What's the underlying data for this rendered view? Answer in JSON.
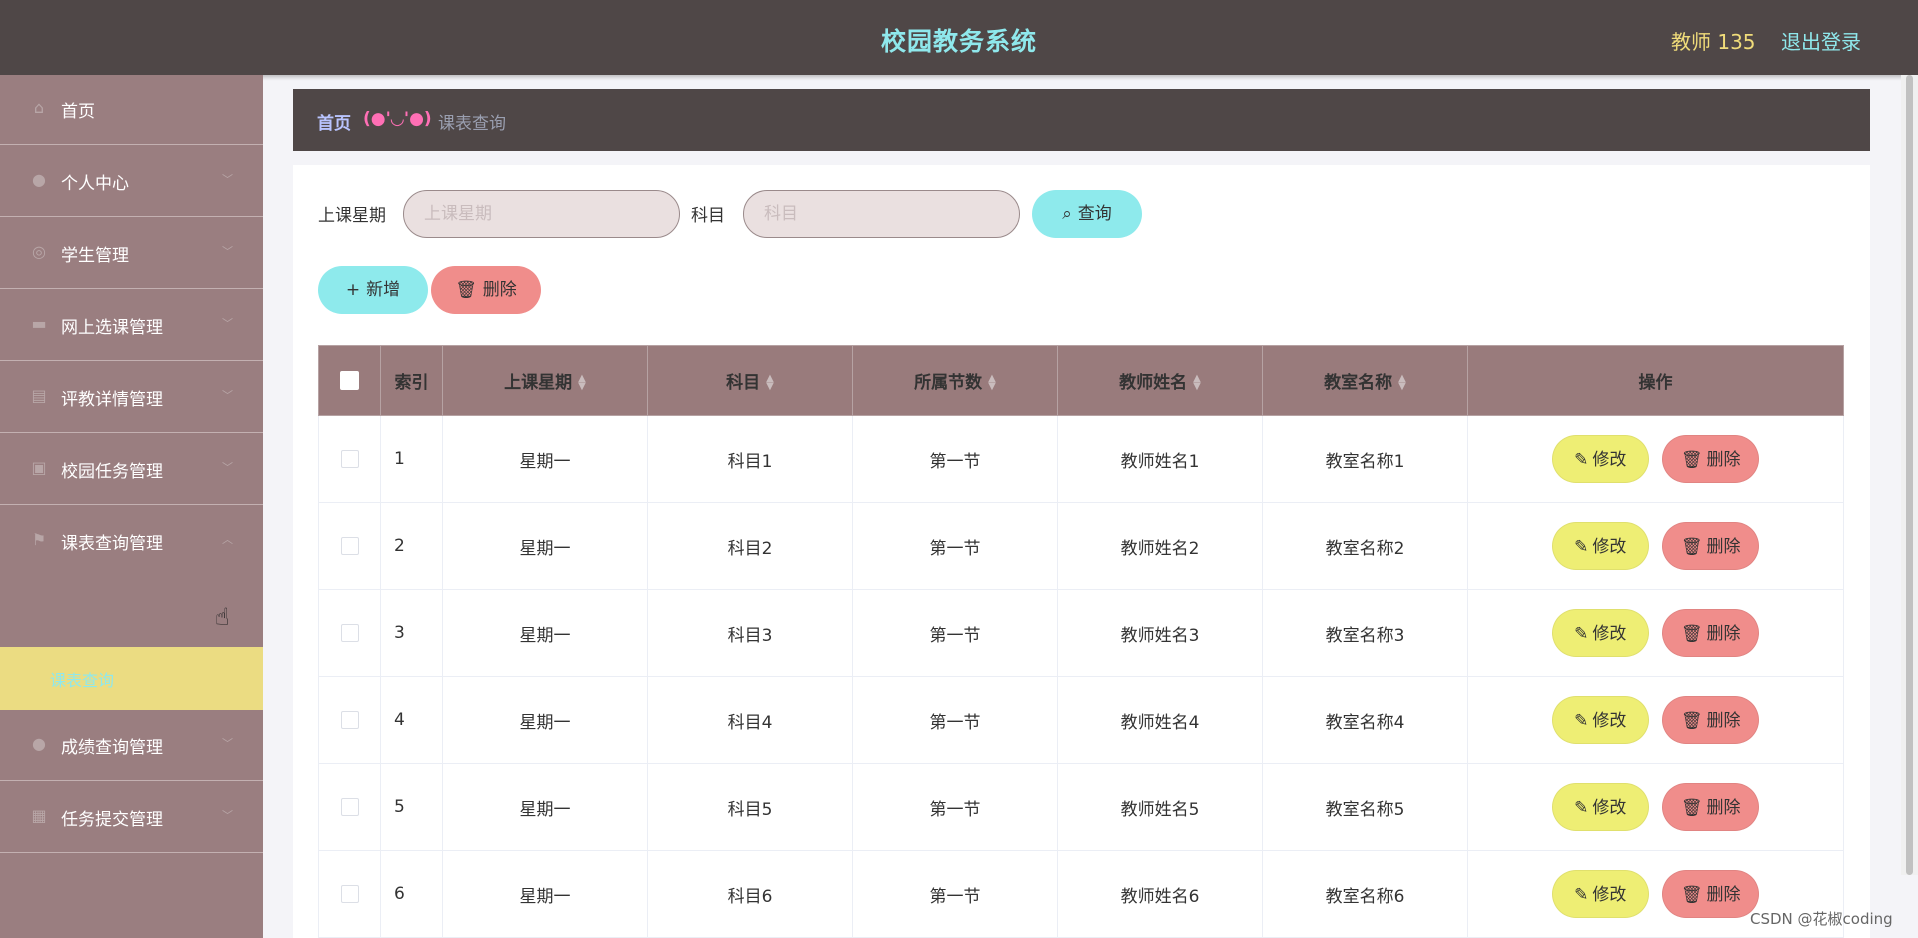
{
  "header": {
    "title": "校园教务系统",
    "user": "教师 135",
    "logout": "退出登录"
  },
  "sidebar": {
    "items": [
      {
        "label": "首页",
        "icon": "home-icon",
        "glyph": "⌂",
        "chevron": ""
      },
      {
        "label": "个人中心",
        "icon": "user-icon",
        "glyph": "●",
        "chevron": "﹀"
      },
      {
        "label": "学生管理",
        "icon": "compass-icon",
        "glyph": "◎",
        "chevron": "﹀"
      },
      {
        "label": "网上选课管理",
        "icon": "monitor-icon",
        "glyph": "▬",
        "chevron": "﹀"
      },
      {
        "label": "评教详情管理",
        "icon": "clipboard-icon",
        "glyph": "▤",
        "chevron": "﹀"
      },
      {
        "label": "校园任务管理",
        "icon": "wallet-icon",
        "glyph": "▣",
        "chevron": "﹀"
      },
      {
        "label": "课表查询管理",
        "icon": "flag-icon",
        "glyph": "⚑",
        "chevron": "︿"
      },
      {
        "label": "成绩查询管理",
        "icon": "person-icon",
        "glyph": "●",
        "chevron": "﹀"
      },
      {
        "label": "任务提交管理",
        "icon": "grid-icon",
        "glyph": "▦",
        "chevron": "﹀"
      }
    ],
    "active_sub": "课表查询"
  },
  "breadcrumb": {
    "home": "首页",
    "emoticon": "(●'◡'●)",
    "current": "课表查询"
  },
  "search": {
    "weekday_label": "上课星期",
    "weekday_placeholder": "上课星期",
    "subject_label": "科目",
    "subject_placeholder": "科目",
    "query_button": "查询"
  },
  "actions": {
    "add": "新增",
    "delete": "删除"
  },
  "table": {
    "columns": [
      "索引",
      "上课星期",
      "科目",
      "所属节数",
      "教师姓名",
      "教室名称",
      "操作"
    ],
    "rows": [
      {
        "index": "1",
        "weekday": "星期一",
        "subject": "科目1",
        "period": "第一节",
        "teacher": "教师姓名1",
        "classroom": "教室名称1"
      },
      {
        "index": "2",
        "weekday": "星期一",
        "subject": "科目2",
        "period": "第一节",
        "teacher": "教师姓名2",
        "classroom": "教室名称2"
      },
      {
        "index": "3",
        "weekday": "星期一",
        "subject": "科目3",
        "period": "第一节",
        "teacher": "教师姓名3",
        "classroom": "教室名称3"
      },
      {
        "index": "4",
        "weekday": "星期一",
        "subject": "科目4",
        "period": "第一节",
        "teacher": "教师姓名4",
        "classroom": "教室名称4"
      },
      {
        "index": "5",
        "weekday": "星期一",
        "subject": "科目5",
        "period": "第一节",
        "teacher": "教师姓名5",
        "classroom": "教室名称5"
      },
      {
        "index": "6",
        "weekday": "星期一",
        "subject": "科目6",
        "period": "第一节",
        "teacher": "教师姓名6",
        "classroom": "教室名称6"
      }
    ],
    "edit_label": "修改",
    "delete_label": "删除"
  },
  "watermark": "CSDN @花椒coding",
  "colors": {
    "header_bg": "#4f4747",
    "sidebar_bg": "#9a7e80",
    "active_sub_bg": "#ebdc82",
    "accent_cyan": "#8eeaec",
    "accent_red": "#f08d8b",
    "accent_yellow": "#eeee74",
    "table_header_bg": "#997b7c"
  }
}
